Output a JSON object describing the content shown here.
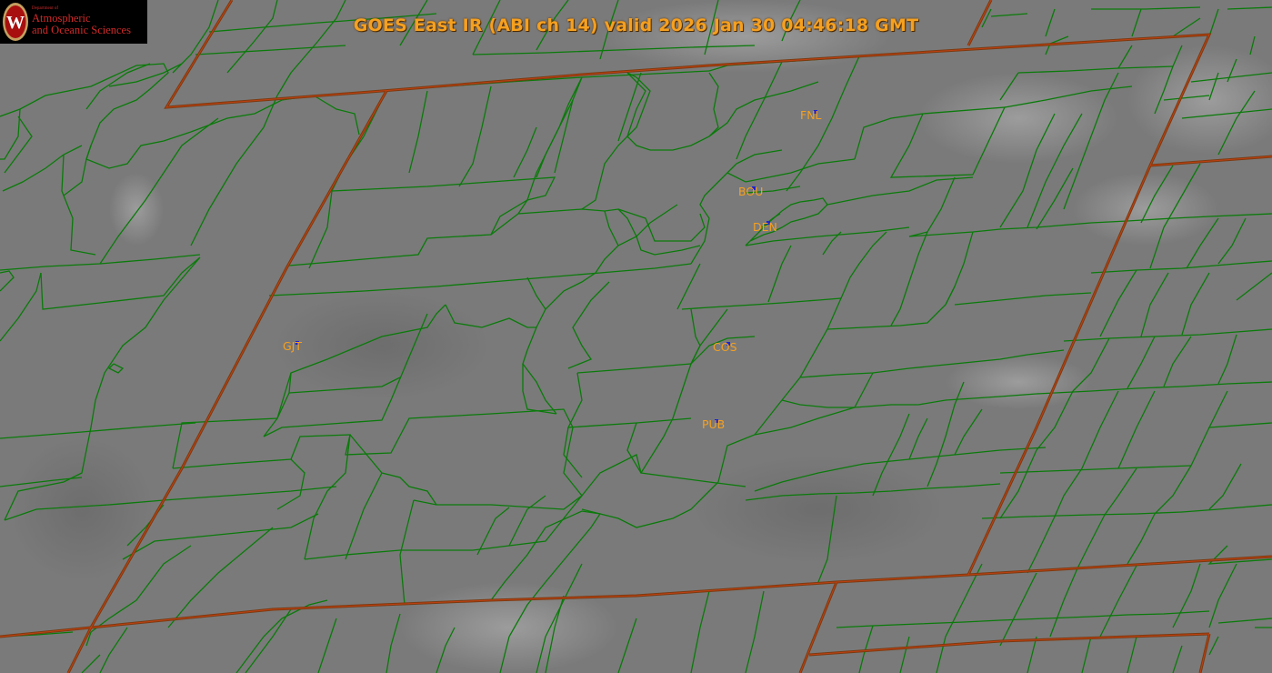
{
  "title": "GOES East IR (ABI ch 14) valid 2026 Jan 30 04:46:18 GMT",
  "logo": {
    "department_of": "Department of",
    "line1": "Atmospheric",
    "line2": "and Oceanic Sciences",
    "shield_letter": "W",
    "icon": "uw-crest-icon"
  },
  "stations": [
    {
      "id": "fnl",
      "label": "FNL"
    },
    {
      "id": "bou",
      "label": "BOU"
    },
    {
      "id": "den",
      "label": "DEN"
    },
    {
      "id": "gjt",
      "label": "GJT"
    },
    {
      "id": "cos",
      "label": "COS"
    },
    {
      "id": "pub",
      "label": "PUB"
    }
  ],
  "colors": {
    "imagery_gray": "#7c7c7c",
    "county_lines": "#0a7a0a",
    "state_lines": "#7a3a10",
    "state_lines_inner": "#c04010",
    "label_orange": "#f5a020",
    "station_marker": "#1a22d0"
  }
}
